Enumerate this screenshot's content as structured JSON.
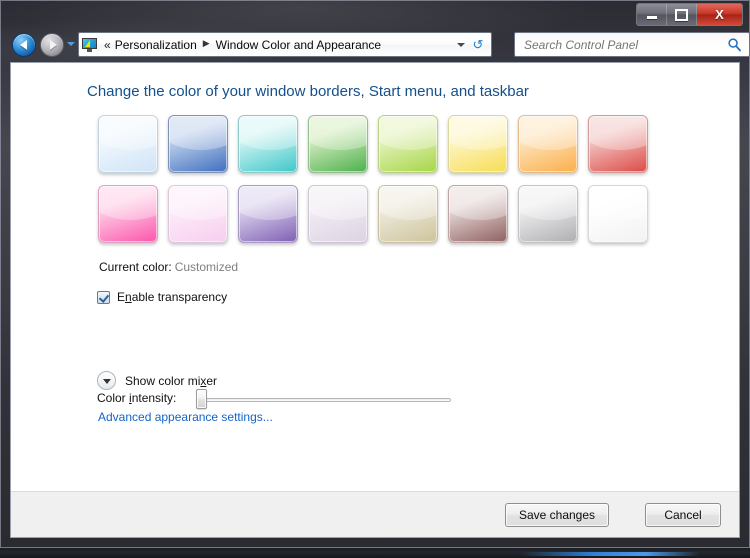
{
  "window": {
    "caption_buttons": [
      {
        "name": "minimize",
        "glyph": "minimize-icon",
        "tooltip": "Minimize"
      },
      {
        "name": "maximize",
        "glyph": "maximize-icon",
        "tooltip": "Maximize"
      },
      {
        "name": "close",
        "glyph": "close-icon",
        "label": "X",
        "tooltip": "Close"
      }
    ],
    "frame_color": "#3a3a45"
  },
  "nav": {
    "back_icon": "back-arrow-icon",
    "forward_icon": "forward-arrow-icon",
    "recent_pages_icon": "chevron-down-icon",
    "breadcrumb_icon": "personalization-icon",
    "breadcrumb_overflow": "«",
    "breadcrumbs": [
      {
        "label": "Personalization"
      },
      {
        "label": "Window Color and Appearance"
      }
    ],
    "separator": "▶",
    "dropdown_icon": "chevron-down-icon",
    "refresh_icon": "refresh-icon",
    "refresh_glyph": "↺"
  },
  "search": {
    "placeholder": "Search Control Panel",
    "value": "",
    "icon": "search-icon",
    "icon_color": "#1f6fc4"
  },
  "main": {
    "heading": "Change the color of your window borders, Start menu, and taskbar",
    "heading_color": "#14508c",
    "swatches": [
      [
        {
          "name": "sky-blue",
          "label": "Sky",
          "top": "#f3f9fe",
          "bottom": "#cfe3f6",
          "border": "#c3d3e2"
        },
        {
          "name": "blue",
          "label": "Blue",
          "top": "#c6d6ee",
          "bottom": "#3f6fc0",
          "border": "#7f94b5"
        },
        {
          "name": "turquoise",
          "label": "Turquoise",
          "top": "#d8f6f5",
          "bottom": "#3fc6c8",
          "border": "#8fc9ca"
        },
        {
          "name": "green",
          "label": "Green",
          "top": "#d9eec4",
          "bottom": "#4cb04c",
          "border": "#93bf8d"
        },
        {
          "name": "lime",
          "label": "Lime",
          "top": "#e7f3c2",
          "bottom": "#a6d646",
          "border": "#b9cf86"
        },
        {
          "name": "yellow",
          "label": "Yellow",
          "top": "#fdf6cc",
          "bottom": "#f7dd55",
          "border": "#ddd69b"
        },
        {
          "name": "orange",
          "label": "Orange",
          "top": "#fde7c4",
          "bottom": "#fbae4a",
          "border": "#e3bc8c"
        },
        {
          "name": "red",
          "label": "Red",
          "top": "#f3ccca",
          "bottom": "#dc4a46",
          "border": "#d39a97"
        }
      ],
      [
        {
          "name": "pink",
          "label": "Pink",
          "top": "#ffd2e8",
          "bottom": "#fb56ab",
          "border": "#e0a0c0"
        },
        {
          "name": "rose",
          "label": "Rose",
          "top": "#fdeef9",
          "bottom": "#f7cdef",
          "border": "#ddc8da"
        },
        {
          "name": "violet",
          "label": "Violet",
          "top": "#ded6ef",
          "bottom": "#7f5fb4",
          "border": "#a99cc2"
        },
        {
          "name": "lavender",
          "label": "Lavender",
          "top": "#f2edf4",
          "bottom": "#ddd2e2",
          "border": "#cfc7d3"
        },
        {
          "name": "khaki",
          "label": "Khaki",
          "top": "#efece0",
          "bottom": "#cdc39a",
          "border": "#c6bfa5"
        },
        {
          "name": "taupe",
          "label": "Taupe",
          "top": "#e8dcdb",
          "bottom": "#8e605f",
          "border": "#bfa6a5"
        },
        {
          "name": "gray",
          "label": "Gray",
          "top": "#f0f0f1",
          "bottom": "#aeaeb2",
          "border": "#c3c3c6"
        },
        {
          "name": "frost",
          "label": "Frost",
          "top": "#ffffff",
          "bottom": "#f2f2f2",
          "border": "#d6d6d6"
        }
      ]
    ],
    "current_color_label": "Current color:",
    "current_color_value": "Customized",
    "transparency": {
      "label_before": "E",
      "label_accel": "n",
      "label_after": "able transparency",
      "checked": true,
      "checkbox_icon": "checkmark-icon"
    },
    "intensity": {
      "label_before": "Color ",
      "label_accel": "i",
      "label_after": "ntensity:",
      "value_percent": 0
    },
    "mixer": {
      "label_before": "Show color mi",
      "label_accel": "x",
      "label_after": "er",
      "expanded": false,
      "toggle_icon": "chevron-down-icon"
    },
    "advanced_link": "Advanced appearance settings...",
    "link_color": "#1464c8"
  },
  "footer": {
    "save_label": "Save changes",
    "cancel_label": "Cancel"
  }
}
